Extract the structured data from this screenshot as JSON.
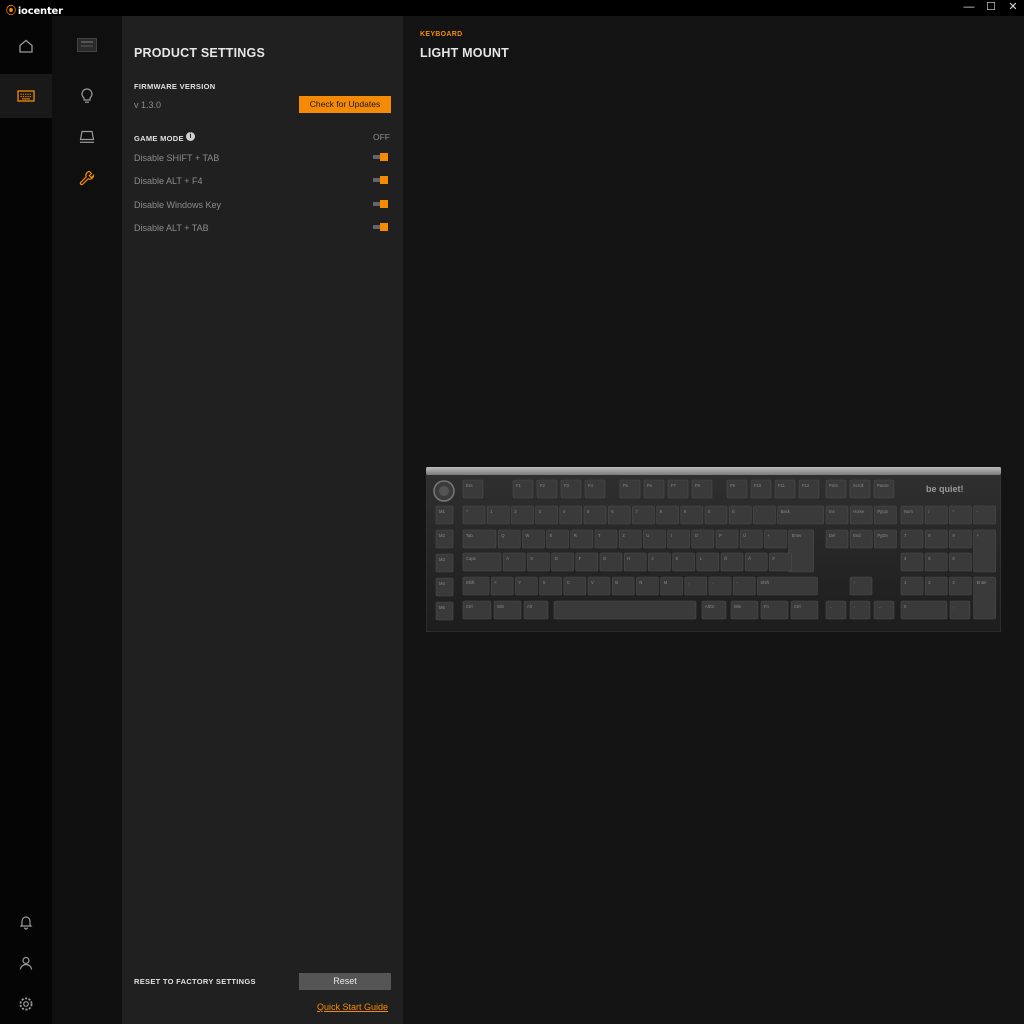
{
  "app": {
    "name": "iocenter"
  },
  "window": {
    "minimize": "—",
    "maximize": "☐",
    "close": "✕"
  },
  "rail": {
    "items": [
      {
        "icon": "home-icon"
      },
      {
        "icon": "keyboard-icon",
        "active": true
      },
      {
        "icon": "bell-icon"
      },
      {
        "icon": "user-icon"
      },
      {
        "icon": "gear-icon"
      }
    ]
  },
  "submenu": {
    "items": [
      {
        "icon": "keyboard-icon"
      },
      {
        "icon": "lightbulb-icon"
      },
      {
        "icon": "keyboard-stand-icon"
      },
      {
        "icon": "wrench-icon",
        "active": true
      }
    ]
  },
  "settings": {
    "title": "PRODUCT SETTINGS",
    "firmware_label": "FIRMWARE VERSION",
    "firmware_version": "v 1.3.0",
    "check_updates": "Check for Updates",
    "game_mode_label": "GAME MODE",
    "game_mode_state": "OFF",
    "options": [
      {
        "label": "Disable SHIFT + TAB",
        "on": true
      },
      {
        "label": "Disable ALT + F4",
        "on": true
      },
      {
        "label": "Disable Windows Key",
        "on": true
      },
      {
        "label": "Disable ALT + TAB",
        "on": true
      }
    ],
    "reset_label": "RESET TO FACTORY SETTINGS",
    "reset_button": "Reset",
    "quick_start": "Quick Start Guide"
  },
  "device": {
    "category": "KEYBOARD",
    "name": "LIGHT MOUNT",
    "brand": "be quiet!",
    "keys": {
      "fn_row": [
        "Esc",
        "F1",
        "F2",
        "F3",
        "F4",
        "F5",
        "F6",
        "F7",
        "F8",
        "F9",
        "F10",
        "F11",
        "F12",
        "Print",
        "Scroll",
        "Pause"
      ],
      "num_row": [
        "^",
        "1",
        "2",
        "3",
        "4",
        "5",
        "6",
        "7",
        "8",
        "9",
        "0",
        "ß",
        "´",
        "Back",
        "Ins",
        "Home",
        "PgUp",
        "Num",
        "/",
        "*",
        "-"
      ],
      "q_row": [
        "Tab",
        "Q",
        "W",
        "E",
        "R",
        "T",
        "Z",
        "U",
        "I",
        "O",
        "P",
        "Ü",
        "+",
        "Enter",
        "Del",
        "End",
        "PgDn",
        "7",
        "8",
        "9",
        "+"
      ],
      "a_row": [
        "Caps",
        "A",
        "S",
        "D",
        "F",
        "G",
        "H",
        "J",
        "K",
        "L",
        "Ö",
        "Ä",
        "#",
        "4",
        "5",
        "6"
      ],
      "z_row": [
        "Shift",
        "<",
        "Y",
        "X",
        "C",
        "V",
        "B",
        "N",
        "M",
        ",",
        ".",
        "-",
        "Shift",
        "↑",
        "1",
        "2",
        "3",
        "Enter"
      ],
      "bottom_row": [
        "Ctrl",
        "Win",
        "Alt",
        "AltGr",
        "Win",
        "Fn",
        "Ctrl",
        "←",
        "↓",
        "→",
        "0",
        ","
      ],
      "macro": [
        "M1",
        "M2",
        "M3",
        "M4",
        "M5"
      ]
    }
  }
}
